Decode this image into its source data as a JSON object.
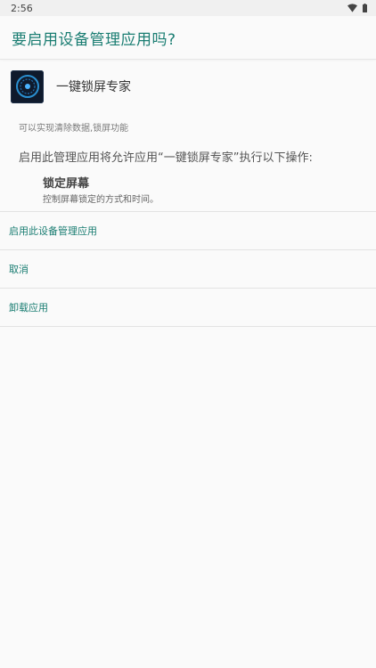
{
  "status_bar": {
    "time": "2:56",
    "icons": [
      "wifi-icon",
      "battery-icon"
    ]
  },
  "dialog": {
    "title": "要启用设备管理应用吗?"
  },
  "app": {
    "name": "一键锁屏专家",
    "icon": "app-lock-icon",
    "description": "可以实现清除数据,锁屏功能"
  },
  "warning": "启用此管理应用将允许应用“一键锁屏专家”执行以下操作:",
  "policy": {
    "title": "锁定屏幕",
    "description": "控制屏幕锁定的方式和时间。"
  },
  "actions": {
    "enable": "启用此设备管理应用",
    "cancel": "取消",
    "uninstall": "卸载应用"
  },
  "colors": {
    "accent": "#1a7d72",
    "background": "#fafafa"
  }
}
